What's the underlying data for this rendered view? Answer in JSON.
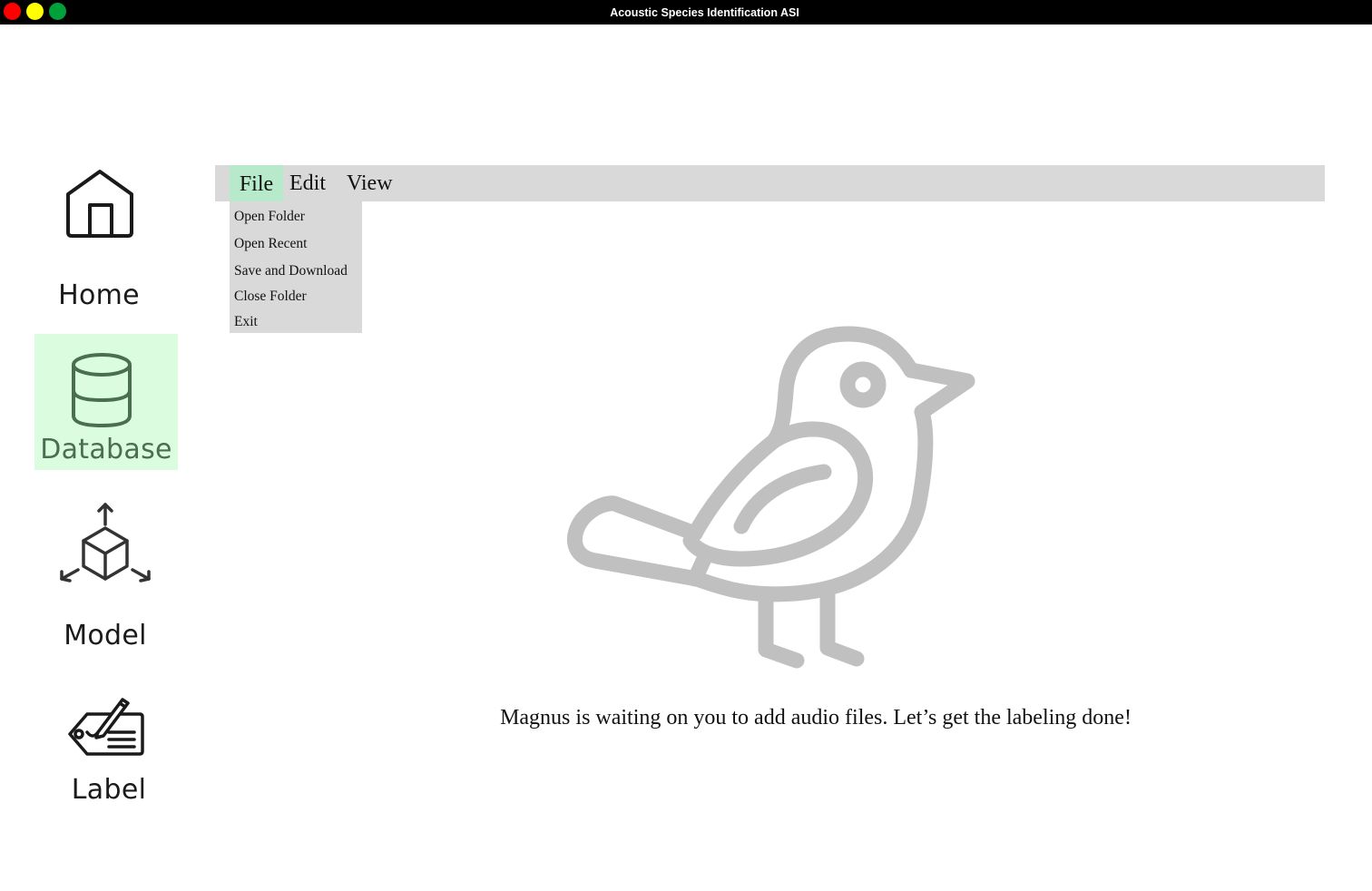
{
  "window": {
    "title": "Acoustic Species Identification ASI",
    "traffic_lights": {
      "close_color": "#ff0000",
      "minimize_color": "#ffff00",
      "maximize_color": "#00a03a"
    }
  },
  "sidebar": {
    "items": [
      {
        "label": "Home",
        "icon": "home-icon",
        "active": false
      },
      {
        "label": "Database",
        "icon": "database-icon",
        "active": true
      },
      {
        "label": "Model",
        "icon": "model-cube-icon",
        "active": false
      },
      {
        "label": "Label",
        "icon": "label-tag-icon",
        "active": false
      }
    ],
    "active_background": "#dcfce0",
    "active_text_color": "#4a6e52"
  },
  "menubar": {
    "menus": [
      "File",
      "Edit",
      "View"
    ],
    "open_menu": "File",
    "highlight_color": "#b7eacb",
    "background": "#d9d9d9"
  },
  "file_menu": {
    "items": [
      "Open Folder",
      "Open Recent",
      "Save and Download",
      "Close Folder",
      "Exit"
    ]
  },
  "main": {
    "illustration": "bird-icon",
    "illustration_color": "#c0c0c0",
    "empty_message": "Magnus is waiting on you to add audio files. Let’s get the labeling done!"
  }
}
